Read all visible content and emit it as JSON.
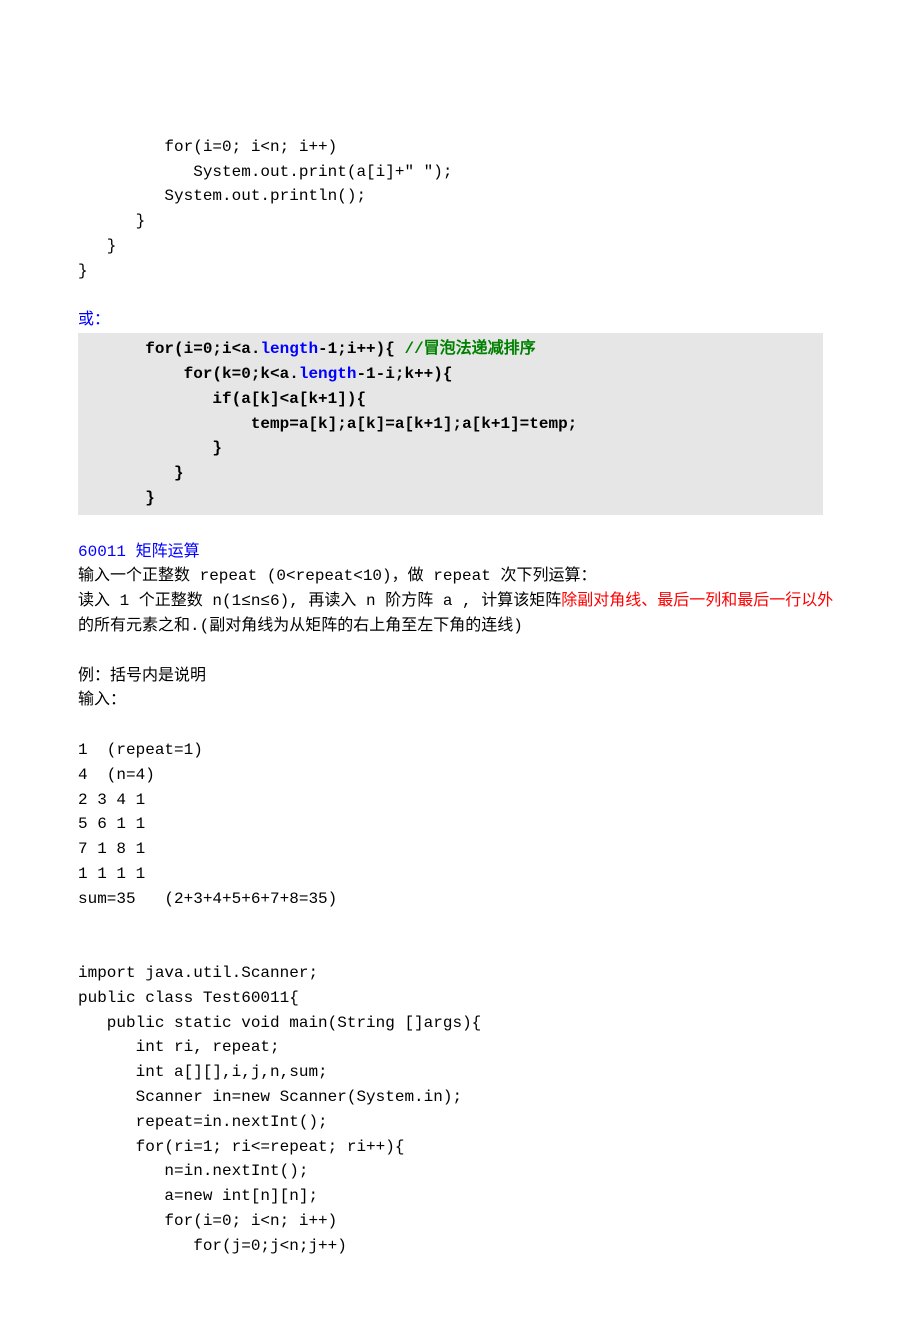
{
  "codeTop": {
    "l1": "         for(i=0; i<n; i++)",
    "l2": "            System.out.print(a[i]+\" \");",
    "l3": "         System.out.println();",
    "l4": "      }",
    "l5": "   }",
    "l6": "}"
  },
  "orLabel": "或：",
  "shaded": {
    "l1a": "       for(i=0;i<a.",
    "l1b": "length",
    "l1c": "-1;i++){ ",
    "l1d": "//冒泡法递减排序",
    "l2a": "           for(k=0;k<a.",
    "l2b": "length",
    "l2c": "-1-i;k++){",
    "l3": "              if(a[k]<a[k+1]){",
    "l4": "                  temp=a[k];a[k]=a[k+1];a[k+1]=temp;",
    "l5": "              }",
    "l6": "          }",
    "l7": "       }"
  },
  "section": {
    "id": "60011",
    "title": "  矩阵运算"
  },
  "desc": {
    "p1": "输入一个正整数 repeat (0<repeat<10)，做 repeat 次下列运算：",
    "p2a": "读入 1 个正整数 n(1≤n≤6), 再读入 n 阶方阵 a , 计算该矩阵",
    "p2b": "除副对角线、最后一列和最后一行以外",
    "p2c": "的所有元素之和.(副对角线为从矩阵的右上角至左下角的连线)"
  },
  "example": {
    "heading": "例：括号内是说明",
    "input_label": "输入：",
    "l1": "1  (repeat=1)",
    "l2": "4  (n=4)",
    "l3": "2 3 4 1",
    "l4": "5 6 1 1",
    "l5": "7 1 8 1",
    "l6": "1 1 1 1",
    "l7": "sum=35   (2+3+4+5+6+7+8=35)"
  },
  "codeBottom": {
    "l1": "import java.util.Scanner;",
    "l2": "public class Test60011{",
    "l3": "   public static void main(String []args){",
    "l4": "      int ri, repeat;",
    "l5": "      int a[][],i,j,n,sum;",
    "l6": "      Scanner in=new Scanner(System.in);",
    "l7": "      repeat=in.nextInt();",
    "l8": "      for(ri=1; ri<=repeat; ri++){",
    "l9": "         n=in.nextInt();",
    "l10": "         a=new int[n][n];",
    "l11": "         for(i=0; i<n; i++)",
    "l12": "            for(j=0;j<n;j++)"
  }
}
